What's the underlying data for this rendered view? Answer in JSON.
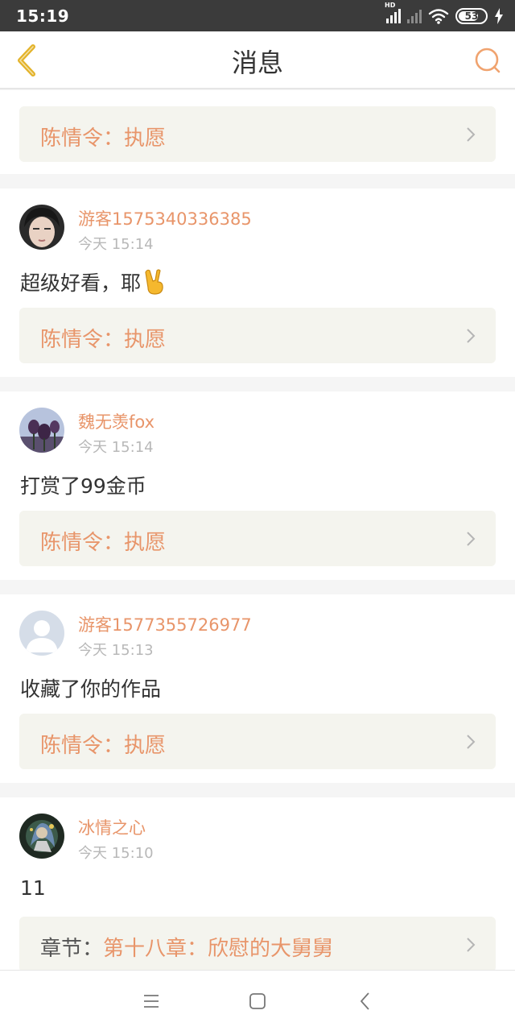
{
  "status_bar": {
    "time": "15:19",
    "network_label": "HD",
    "battery_level": "53"
  },
  "header": {
    "title": "消息"
  },
  "messages": [
    {
      "link_text": "陈情令：执愿"
    },
    {
      "username": "游客1575340336385",
      "time": "今天 15:14",
      "content": "超级好看，耶",
      "link_text": "陈情令：执愿"
    },
    {
      "username": "魏无羡fox",
      "time": "今天 15:14",
      "content": "打赏了99金币",
      "link_text": "陈情令：执愿"
    },
    {
      "username": "游客1577355726977",
      "time": "今天 15:13",
      "content": "收藏了你的作品",
      "link_text": "陈情令：执愿"
    },
    {
      "username": "冰情之心",
      "time": "今天 15:10",
      "content": "11",
      "link_prefix": "章节：",
      "link_text": "第十八章：欣慰的大舅舅"
    }
  ],
  "colors": {
    "accent": "#e8956a",
    "back_icon": "#e3b32a",
    "card_link_bg": "#f4f4ee",
    "status_bar_bg": "#3b3b3b"
  }
}
